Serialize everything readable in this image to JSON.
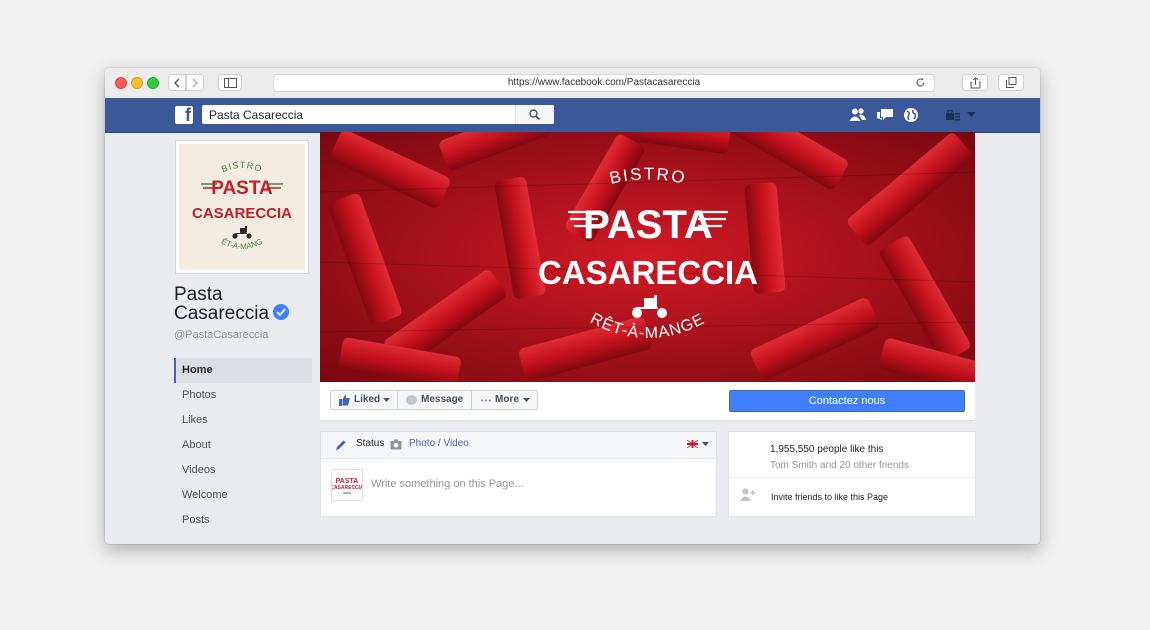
{
  "browser": {
    "url": "https://www.facebook.com/Pastacasareccia"
  },
  "fb": {
    "logo": "f",
    "search_value": "Pasta Casareccia"
  },
  "page": {
    "name_line1": "Pasta",
    "name_line2": "Casareccia",
    "handle": "@PastaCasareccia"
  },
  "logo": {
    "bistro": "BISTRO",
    "pasta": "PASTA",
    "casareccia": "CASARECCIA",
    "tagline": "PRÊT-À-MANGER",
    "small_pasta": "PASTA",
    "small_casareccia": "CASARECCIA"
  },
  "sidebar": {
    "items": [
      {
        "label": "Home"
      },
      {
        "label": "Photos"
      },
      {
        "label": "Likes"
      },
      {
        "label": "About"
      },
      {
        "label": "Videos"
      },
      {
        "label": "Welcome"
      },
      {
        "label": "Posts"
      }
    ]
  },
  "actions": {
    "liked": "Liked",
    "message": "Message",
    "more": "More",
    "contact": "Contactez nous"
  },
  "composer": {
    "status": "Status",
    "photo_video": "Photo / Video",
    "placeholder": "Write something on this Page..."
  },
  "likes": {
    "count": "1,955,550 people like this",
    "friends": "Tom Smith and 20 other friends",
    "invite": "Invite friends to like this Page"
  },
  "colors": {
    "fb_blue": "#3b5998",
    "cover_red": "#b3101c",
    "cta_blue": "#4080ff",
    "brand_red": "#c0202a",
    "brand_green": "#3a8a4a"
  }
}
